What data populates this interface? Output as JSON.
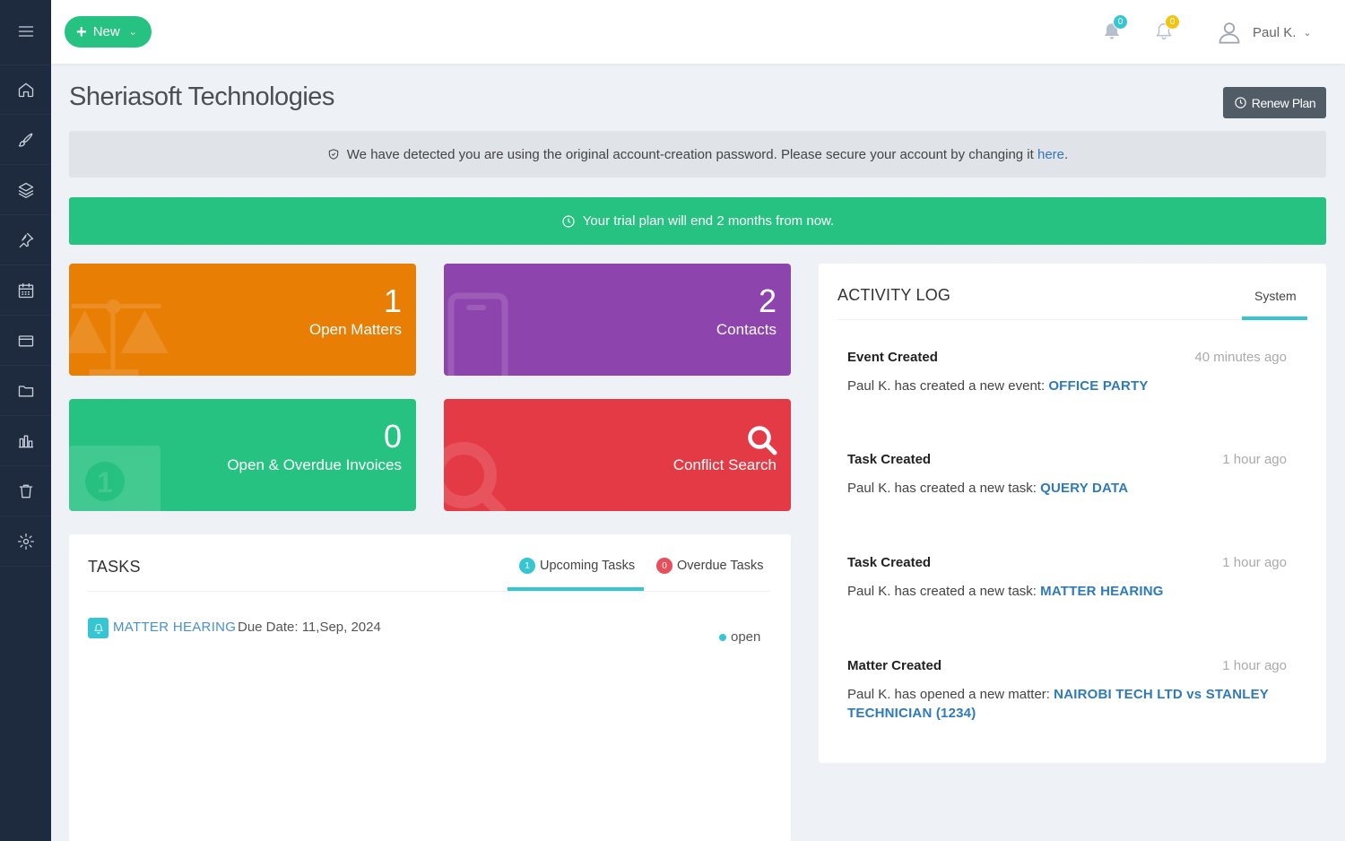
{
  "sidebar": {
    "items": [
      {
        "icon": "menu-icon"
      },
      {
        "icon": "home-icon"
      },
      {
        "icon": "brush-icon"
      },
      {
        "icon": "layers-icon"
      },
      {
        "icon": "pin-icon"
      },
      {
        "icon": "calendar-icon"
      },
      {
        "icon": "credit-card-icon"
      },
      {
        "icon": "folder-icon"
      },
      {
        "icon": "bar-chart-icon"
      },
      {
        "icon": "trash-icon"
      },
      {
        "icon": "settings-icon"
      }
    ]
  },
  "topbar": {
    "new_label": "New",
    "notifications": [
      {
        "icon": "bell-filled-icon",
        "count": "0",
        "color": "#36c6d3"
      },
      {
        "icon": "bell-outline-icon",
        "count": "0",
        "color": "#f1c40f"
      }
    ],
    "user_name": "Paul K."
  },
  "page": {
    "title": "Sheriasoft Technologies",
    "renew_label": "Renew Plan"
  },
  "alerts": {
    "password_text": "We have detected you are using the original account-creation password. Please secure your account by changing it ",
    "password_link": "here",
    "password_end": ".",
    "trial_text": "Your trial plan will end 2 months from now."
  },
  "tiles": [
    {
      "value": "1",
      "label": "Open Matters",
      "color": "#e87e04",
      "icon": "scales-icon"
    },
    {
      "value": "2",
      "label": "Contacts",
      "color": "#8e44ad",
      "icon": "phone-icon"
    },
    {
      "value": "0",
      "label": "Open & Overdue Invoices",
      "color": "#26c281",
      "icon": "money-icon"
    },
    {
      "value": "",
      "label": "Conflict Search",
      "color": "#e43a45",
      "icon": "search-icon"
    }
  ],
  "tasks": {
    "title": "TASKS",
    "tabs": [
      {
        "label": "Upcoming Tasks",
        "count": "1",
        "color": "#36c6d3"
      },
      {
        "label": "Overdue Tasks",
        "count": "0",
        "color": "#e7505a"
      }
    ],
    "items": [
      {
        "name": "MATTER HEARING",
        "due": "Due Date: 11,Sep, 2024",
        "status": "open"
      }
    ]
  },
  "activity": {
    "title": "ACTIVITY LOG",
    "tab": "System",
    "items": [
      {
        "title": "Event Created",
        "time": "40 minutes ago",
        "desc": "Paul K. has created a new event: ",
        "ref": "OFFICE PARTY"
      },
      {
        "title": "Task Created",
        "time": "1 hour ago",
        "desc": "Paul K. has created a new task: ",
        "ref": "QUERY DATA"
      },
      {
        "title": "Task Created",
        "time": "1 hour ago",
        "desc": "Paul K. has created a new task: ",
        "ref": "MATTER HEARING"
      },
      {
        "title": "Matter Created",
        "time": "1 hour ago",
        "desc": "Paul K. has opened a new matter: ",
        "ref": "NAIROBI TECH LTD vs STANLEY TECHNICIAN (1234)"
      }
    ]
  }
}
